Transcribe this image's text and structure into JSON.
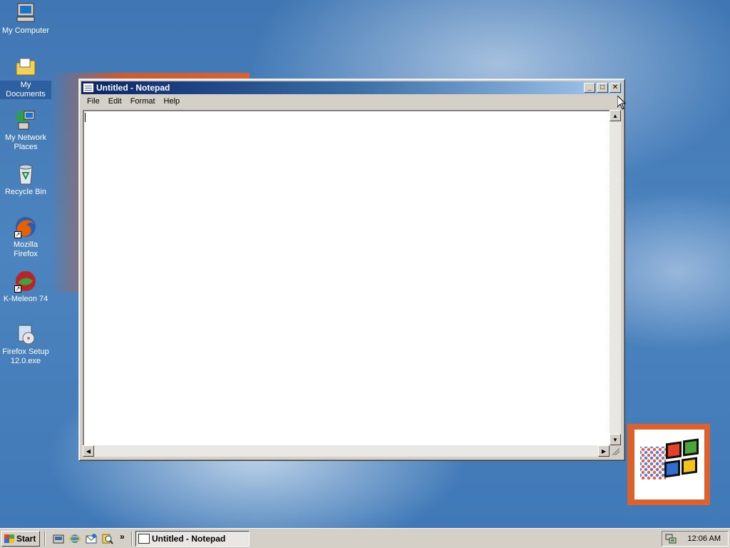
{
  "desktop": {
    "icons": [
      {
        "label": "My Computer",
        "icon": "my-computer-icon"
      },
      {
        "label": "My Documents",
        "icon": "my-documents-icon"
      },
      {
        "label": "My Network Places",
        "icon": "network-places-icon"
      },
      {
        "label": "Recycle Bin",
        "icon": "recycle-bin-icon"
      },
      {
        "label": "Mozilla Firefox",
        "icon": "firefox-icon"
      },
      {
        "label": "K-Meleon 74",
        "icon": "kmeleon-icon"
      },
      {
        "label": "Firefox Setup 12.0.exe",
        "icon": "installer-icon"
      }
    ]
  },
  "notepad": {
    "title": "Untitled - Notepad",
    "menu": [
      "File",
      "Edit",
      "Format",
      "Help"
    ],
    "content": "",
    "controls": {
      "minimize": "_",
      "maximize": "□",
      "close": "✕"
    }
  },
  "taskbar": {
    "start_label": "Start",
    "quick_launch": [
      "show-desktop-icon",
      "internet-explorer-icon",
      "outlook-express-icon",
      "search-icon"
    ],
    "more_chevron": "»",
    "tasks": [
      {
        "label": "Untitled - Notepad",
        "active": true
      }
    ],
    "clock": "12:06 AM"
  },
  "colors": {
    "desktop_bg": "#3f76b3",
    "title_active_start": "#0a246a",
    "title_active_end": "#a6caf0",
    "face": "#d4d0c8",
    "accent_orange": "#d86236"
  }
}
